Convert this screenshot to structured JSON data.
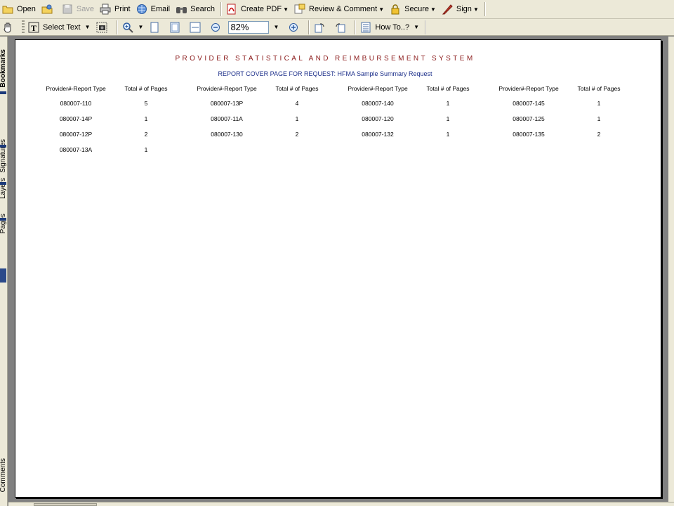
{
  "toolbar1": {
    "open": "Open",
    "save": "Save",
    "print": "Print",
    "email": "Email",
    "search": "Search",
    "create_pdf": "Create PDF",
    "review_comment": "Review & Comment",
    "secure": "Secure",
    "sign": "Sign"
  },
  "toolbar2": {
    "select_text": "Select Text",
    "zoom_value": "82%",
    "how_to": "How To..?"
  },
  "nav_tabs": {
    "bookmarks": "Bookmarks",
    "signatures": "Signatures",
    "layers": "Layers",
    "pages": "Pages",
    "comments": "Comments"
  },
  "document": {
    "title": "PROVIDER STATISTICAL AND REIMBURSEMENT SYSTEM",
    "subtitle": "REPORT COVER PAGE FOR REQUEST: HFMA Sample Summary Request",
    "col_header_1": "Provider#-Report Type",
    "col_header_2": "Total # of Pages",
    "groups": [
      {
        "rows": [
          {
            "provider": "080007-110",
            "pages": "5"
          },
          {
            "provider": "080007-14P",
            "pages": "1"
          },
          {
            "provider": "080007-12P",
            "pages": "2"
          },
          {
            "provider": "080007-13A",
            "pages": "1"
          }
        ]
      },
      {
        "rows": [
          {
            "provider": "080007-13P",
            "pages": "4"
          },
          {
            "provider": "080007-11A",
            "pages": "1"
          },
          {
            "provider": "080007-130",
            "pages": "2"
          }
        ]
      },
      {
        "rows": [
          {
            "provider": "080007-140",
            "pages": "1"
          },
          {
            "provider": "080007-120",
            "pages": "1"
          },
          {
            "provider": "080007-132",
            "pages": "1"
          }
        ]
      },
      {
        "rows": [
          {
            "provider": "080007-145",
            "pages": "1"
          },
          {
            "provider": "080007-125",
            "pages": "1"
          },
          {
            "provider": "080007-135",
            "pages": "2"
          }
        ]
      }
    ]
  },
  "colors": {
    "title_red": "#8b1a1a",
    "subtitle_blue": "#1c2f8a",
    "chrome": "#ece9d8"
  }
}
